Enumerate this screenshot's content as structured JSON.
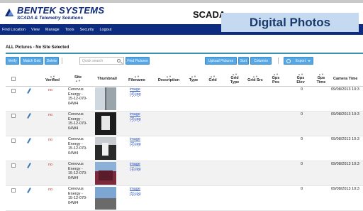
{
  "header": {
    "brand": "BENTEK SYSTEMS",
    "brand_sub": "SCADA & Telemetry Solutions",
    "app_title": "SCADA"
  },
  "overlay_title": "Digital Photos",
  "nav": [
    "Find Location",
    "View",
    "Manage",
    "Tools",
    "Security",
    "Logout"
  ],
  "section_title": "ALL Pictures - No Site Selected",
  "toolbar": {
    "verify": "Verify",
    "match_grid": "Match Grid",
    "delete": "Delete",
    "search_placeholder": "Quick search",
    "find_pictures": "Find Pictures",
    "upload_pictures": "Upload Pictures",
    "sort": "Sort",
    "columns": "Columns",
    "export": "Export"
  },
  "columns": {
    "verified": "Verified",
    "site": "Site",
    "thumbnail": "Thumbnail",
    "filename": "Filename",
    "description": "Description",
    "type": "Type",
    "grid": "Grid",
    "grid_type": "Grid Type",
    "grid_src": "Grid Src",
    "gps_pos": "Gps Pos",
    "gps_elev": "Gps Elev",
    "gps_time": "Gps Time",
    "camera_time": "Camera Time"
  },
  "rows": [
    {
      "verified": "no",
      "site": "Cenovus Energy - 15-12-070-04W4",
      "filename": "image (4).jpg",
      "gps_elev": "0",
      "camera_time": "09/08/2013 10:3"
    },
    {
      "verified": "no",
      "site": "Cenovus Energy - 15-12-070-04W4",
      "filename": "image (3).jpg",
      "gps_elev": "0",
      "camera_time": "09/08/2013 10:3"
    },
    {
      "verified": "no",
      "site": "Cenovus Energy - 15-12-070-04W4",
      "filename": "image (2).jpg",
      "gps_elev": "0",
      "camera_time": "09/08/2013 10:3"
    },
    {
      "verified": "no",
      "site": "Cenovus Energy - 15-12-070-04W4",
      "filename": "image (1).jpg",
      "gps_elev": "0",
      "camera_time": "09/08/2013 10:3"
    },
    {
      "verified": "no",
      "site": "Cenovus Energy - 15-12-070-04W4",
      "filename": "image (5).jpg",
      "gps_elev": "0",
      "camera_time": "09/08/2013 10:3"
    }
  ]
}
